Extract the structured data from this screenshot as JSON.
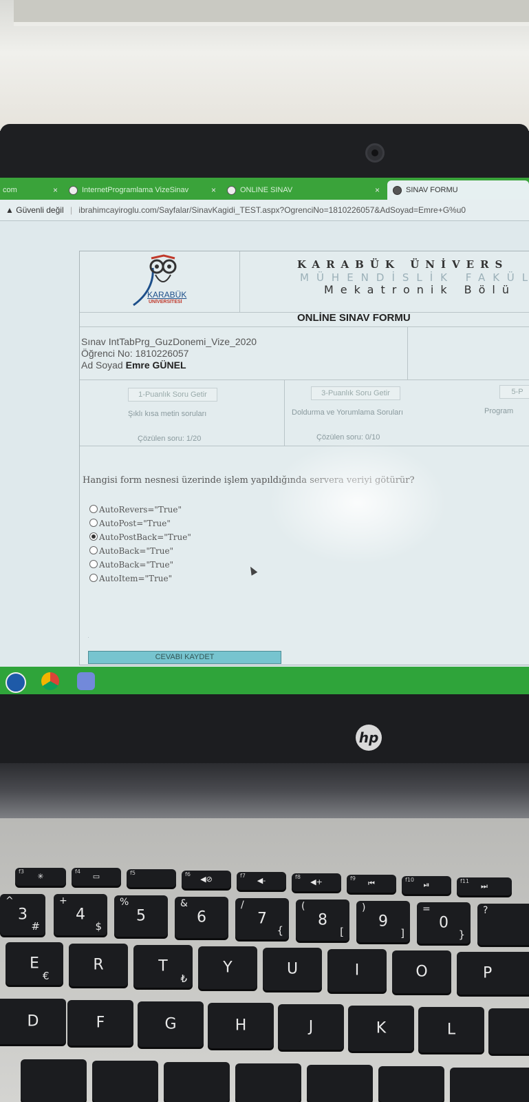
{
  "browser": {
    "tabs": [
      {
        "label": "com",
        "close": "×"
      },
      {
        "label": "InternetProgramlama VizeSinav",
        "close": "×"
      },
      {
        "label": "ONLINE SINAV",
        "close": "×"
      },
      {
        "label": "SINAV FORMU",
        "close": ""
      }
    ],
    "security_label": "Güvenli değil",
    "url": "ibrahimcayiroglu.com/Sayfalar/SinavKagidi_TEST.aspx?OgrenciNo=1810226057&AdSoyad=Emre+G%u0"
  },
  "header": {
    "logo_text": "KARABÜK",
    "logo_subtext": "ÜNİVERSİTESİ",
    "line1": "KARABÜK ÜNİVERS",
    "line2": "MÜHENDİSLİK FAKÜL",
    "line3": "Mekatronik Bölü",
    "form_title": "ONLİNE SINAV FORMU"
  },
  "exam_info": {
    "exam_label": "Sınav",
    "exam_value": "IntTabPrg_GuzDonemi_Vize_2020",
    "student_no_label": "Öğrenci No:",
    "student_no_value": "1810226057",
    "name_label": "Ad Soyad",
    "name_value": "Emre GÜNEL"
  },
  "question_groups": [
    {
      "button": "1-Puanlık Soru Getir",
      "type": "Şıklı kısa metin soruları",
      "solved": "Çözülen soru: 1/20"
    },
    {
      "button": "3-Puanlık Soru Getir",
      "type": "Doldurma ve Yorumlama Soruları",
      "solved": "Çözülen soru: 0/10"
    },
    {
      "button": "5-P",
      "type": "Program",
      "solved": ""
    }
  ],
  "question": {
    "text": "Hangisi form nesnesi üzerinde işlem yapıldığında servera veriyi götürür?",
    "options": [
      {
        "label": "AutoRevers=\"True\"",
        "selected": false
      },
      {
        "label": "AutoPost=\"True\"",
        "selected": false
      },
      {
        "label": "AutoPostBack=\"True\"",
        "selected": true
      },
      {
        "label": "AutoBack=\"True\"",
        "selected": false
      },
      {
        "label": "AutoBack=\"True\"",
        "selected": false
      },
      {
        "label": "AutoItem=\"True\"",
        "selected": false
      }
    ]
  },
  "save_button": "CEVABI KAYDET",
  "laptop": {
    "brand": "hp"
  },
  "keyboard": {
    "fkeys": [
      {
        "fn": "f3",
        "sym": "✳"
      },
      {
        "fn": "f4",
        "sym": "▭"
      },
      {
        "fn": "f5",
        "sym": ""
      },
      {
        "fn": "f6",
        "sym": "◀⊘"
      },
      {
        "fn": "f7",
        "sym": "◀-"
      },
      {
        "fn": "f8",
        "sym": "◀+"
      },
      {
        "fn": "f9",
        "sym": "⏮"
      },
      {
        "fn": "f10",
        "sym": "⏯"
      },
      {
        "fn": "f11",
        "sym": "⏭"
      }
    ],
    "number_row": [
      {
        "main": "3",
        "top": "^",
        "sub": "#"
      },
      {
        "main": "4",
        "top": "+",
        "sub": "$"
      },
      {
        "main": "5",
        "top": "%",
        "sub": ""
      },
      {
        "main": "6",
        "top": "&",
        "sub": ""
      },
      {
        "main": "7",
        "top": "/",
        "sub": "{"
      },
      {
        "main": "8",
        "top": "(",
        "sub": "["
      },
      {
        "main": "9",
        "top": ")",
        "sub": "]"
      },
      {
        "main": "0",
        "top": "=",
        "sub": "}"
      },
      {
        "main": "",
        "top": "?",
        "sub": ""
      }
    ],
    "top_row": [
      {
        "main": "E",
        "sub": "€"
      },
      {
        "main": "R",
        "sub": ""
      },
      {
        "main": "T",
        "sub": "₺"
      },
      {
        "main": "Y",
        "sub": ""
      },
      {
        "main": "U",
        "sub": ""
      },
      {
        "main": "I",
        "sub": ""
      },
      {
        "main": "O",
        "sub": ""
      },
      {
        "main": "P",
        "sub": ""
      }
    ],
    "home_row": [
      {
        "main": "D"
      },
      {
        "main": "F"
      },
      {
        "main": "G"
      },
      {
        "main": "H"
      },
      {
        "main": "J"
      },
      {
        "main": "K"
      },
      {
        "main": "L"
      }
    ]
  },
  "colors": {
    "tabbar": "#3aa33a",
    "taskbar": "#2fa43a",
    "save_button": "#77c4cf"
  }
}
